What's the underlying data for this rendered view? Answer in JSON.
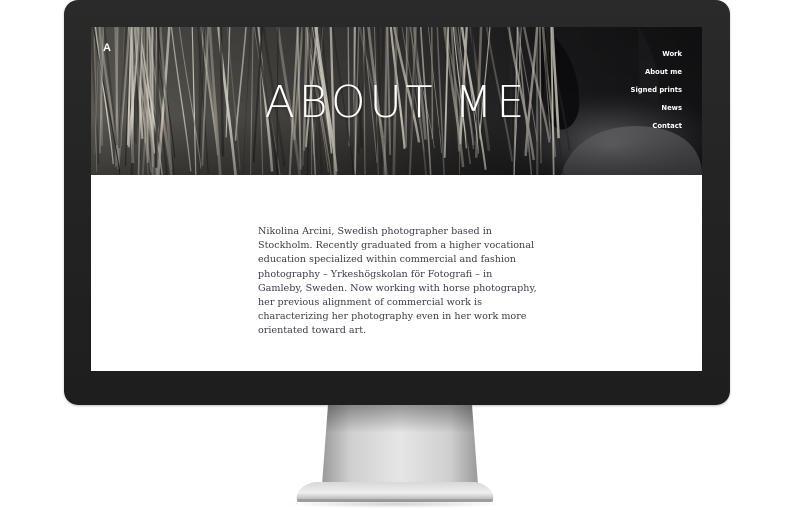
{
  "site": {
    "logo": "A",
    "title": "ABOUT ME"
  },
  "nav": {
    "items": [
      "Work",
      "About me",
      "Signed prints",
      "News",
      "Contact"
    ]
  },
  "about": {
    "text": "Nikolina Arcini, Swedish photographer based in Stockholm. Recently graduated from a higher vocational education specialized within commercial and fashion photography – Yrkeshögskolan för Fotografi – in Gamleby, Sweden. Now working with horse photography, her previous alignment of commercial work is characterizing her photography even in her work more orientated toward art."
  },
  "hero": {
    "image": "horse-mane-photo"
  },
  "colors": {
    "monitor_bezel": "#222222",
    "screen_bg": "#ffffff",
    "body_text": "#3c3c48",
    "hero_text": "#ffffff"
  }
}
